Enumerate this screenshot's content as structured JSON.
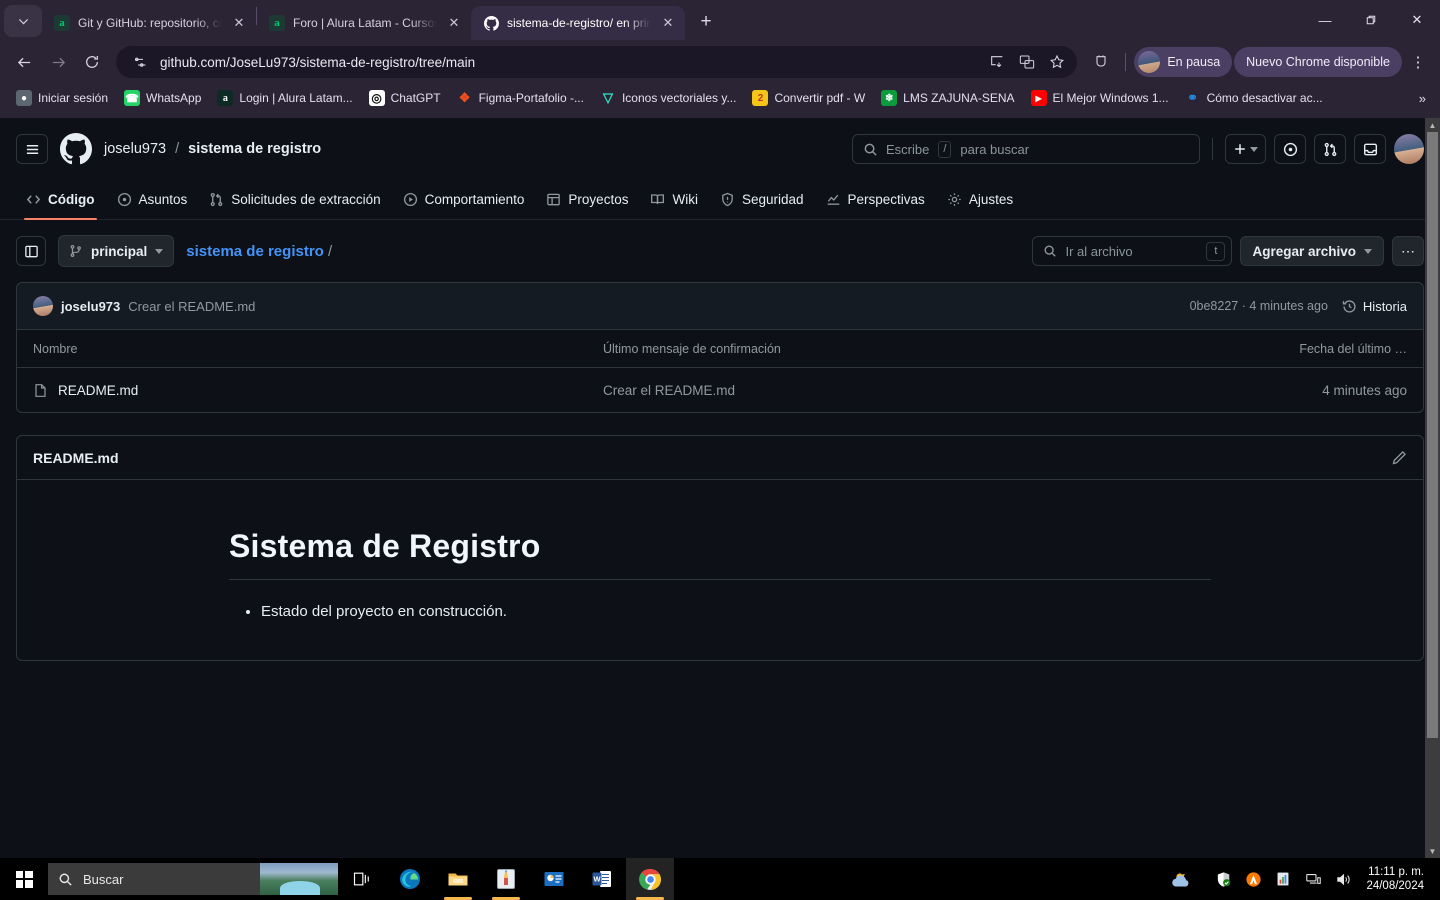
{
  "browser": {
    "tabs": [
      {
        "title": "Git y GitHub: repositorio, comm",
        "favicon": "alura-icon",
        "active": false
      },
      {
        "title": "Foro | Alura Latam - Cursos onli",
        "favicon": "alura-icon",
        "active": false
      },
      {
        "title": "sistema-de-registro/ en principa",
        "favicon": "github-icon",
        "active": true
      }
    ],
    "new_tab_label": "+",
    "window_controls": {
      "minimize": "—",
      "maximize": "❐",
      "close": "✕"
    },
    "omnibox": {
      "url": "github.com/JoseLu973/sistema-de-registro/tree/main"
    },
    "profile_pill": "En pausa",
    "update_pill": "Nuevo Chrome disponible",
    "bookmarks": [
      {
        "label": "Iniciar sesión",
        "icon": "globe-icon",
        "color": "#4a5560",
        "glyph": "●"
      },
      {
        "label": "WhatsApp",
        "icon": "whatsapp-icon",
        "color": "#25d366",
        "glyph": "✆"
      },
      {
        "label": "Login | Alura Latam...",
        "icon": "alura-icon",
        "color": "#0d2a25",
        "glyph": "a"
      },
      {
        "label": "ChatGPT",
        "icon": "chatgpt-icon",
        "color": "#ffffff",
        "glyph": "◎"
      },
      {
        "label": "Figma-Portafolio -...",
        "icon": "figma-icon",
        "color": "#2b2435",
        "glyph": "❖"
      },
      {
        "label": "Iconos vectoriales y...",
        "icon": "flaticon-icon",
        "color": "#2b2435",
        "glyph": "▽"
      },
      {
        "label": "Convertir pdf - W",
        "icon": "pdf-icon",
        "color": "#f5c518",
        "glyph": "2"
      },
      {
        "label": "LMS ZAJUNA-SENA",
        "icon": "sena-icon",
        "color": "#0b9a3c",
        "glyph": "❄"
      },
      {
        "label": "El Mejor Windows 1...",
        "icon": "youtube-icon",
        "color": "#ff0000",
        "glyph": "▶"
      },
      {
        "label": "Cómo desactivar ac...",
        "icon": "link-icon",
        "color": "#1e88e5",
        "glyph": "⚭"
      }
    ],
    "bookmarks_overflow": "»"
  },
  "github": {
    "owner": "joselu973",
    "repo_name": "sistema de registro",
    "separator": "/",
    "search_placeholder_prefix": "Escribe",
    "search_key": "/",
    "search_placeholder_suffix": "para buscar",
    "nav": [
      {
        "label": "Código",
        "icon": "code-icon",
        "active": true
      },
      {
        "label": "Asuntos",
        "icon": "issue-opened-icon",
        "active": false
      },
      {
        "label": "Solicitudes de extracción",
        "icon": "git-pull-request-icon",
        "active": false
      },
      {
        "label": "Comportamiento",
        "icon": "play-icon",
        "active": false
      },
      {
        "label": "Proyectos",
        "icon": "table-icon",
        "active": false
      },
      {
        "label": "Wiki",
        "icon": "book-icon",
        "active": false
      },
      {
        "label": "Seguridad",
        "icon": "shield-icon",
        "active": false
      },
      {
        "label": "Perspectivas",
        "icon": "graph-icon",
        "active": false
      },
      {
        "label": "Ajustes",
        "icon": "gear-icon",
        "active": false
      }
    ],
    "toolbar": {
      "branch": "principal",
      "path_crumb": "sistema de registro",
      "path_slash": "/",
      "file_search_placeholder": "Ir al archivo",
      "file_search_key": "t",
      "add_file_label": "Agregar archivo",
      "more_label": "…"
    },
    "commit_bar": {
      "author": "joselu973",
      "message": "Crear el README.md",
      "sha": "0be8227",
      "sha_separator": "·",
      "relative_time": "4 minutes ago",
      "history_label": "Historia"
    },
    "file_table": {
      "columns": [
        "Nombre",
        "Último mensaje de confirmación",
        "Fecha del último …"
      ],
      "rows": [
        {
          "name": "README.md",
          "icon": "file-icon",
          "message": "Crear el README.md",
          "date": "4 minutes ago"
        }
      ]
    },
    "readme": {
      "title": "README.md",
      "edit_icon": "pencil-icon",
      "heading": "Sistema de Registro",
      "bullets": [
        "Estado del proyecto en construcción."
      ]
    },
    "accent_color": "#f78166",
    "link_color": "#4493f8"
  },
  "taskbar": {
    "search_placeholder": "Buscar",
    "apps": [
      {
        "name": "task-view",
        "icon": "task-view-icon"
      },
      {
        "name": "edge",
        "icon": "edge-icon"
      },
      {
        "name": "file-explorer",
        "icon": "folder-icon"
      },
      {
        "name": "paint",
        "icon": "paint-icon"
      },
      {
        "name": "powerpoint",
        "icon": "powerpoint-icon"
      },
      {
        "name": "word",
        "icon": "word-icon"
      },
      {
        "name": "chrome",
        "icon": "chrome-icon"
      }
    ],
    "tray": [
      "weather-icon",
      "defender-icon",
      "avast-icon",
      "stats-icon",
      "network-icon",
      "volume-icon"
    ],
    "time": "11:11 p. m.",
    "date": "24/08/2024"
  }
}
